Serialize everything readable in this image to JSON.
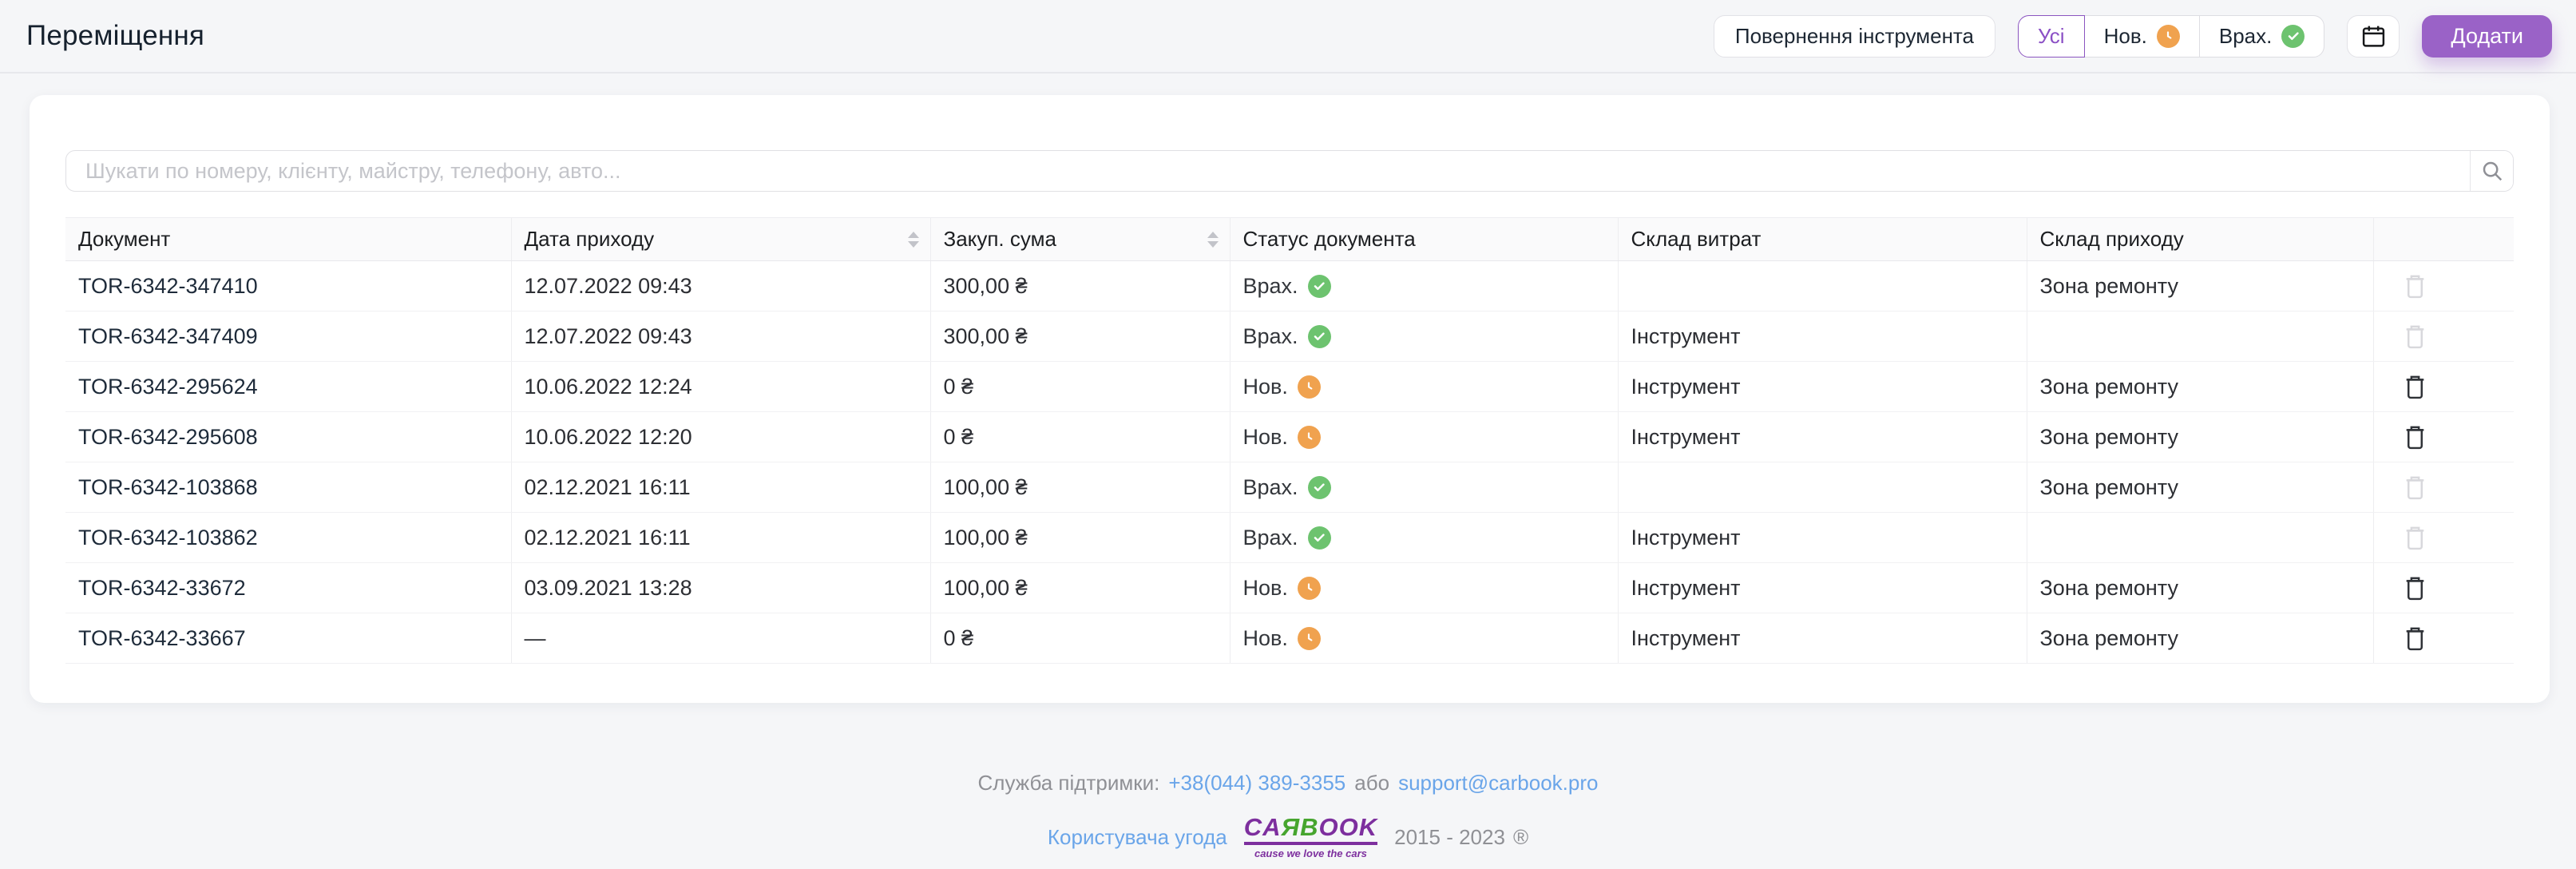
{
  "page": {
    "title": "Переміщення"
  },
  "toolbar": {
    "return_button": "Повернення інструмента",
    "filters": [
      {
        "label": "Усі",
        "active": true,
        "badge": null
      },
      {
        "label": "Нов.",
        "active": false,
        "badge": "new"
      },
      {
        "label": "Врах.",
        "active": false,
        "badge": "done"
      }
    ],
    "calendar_button": "calendar",
    "add_button": "Додати"
  },
  "search": {
    "placeholder": "Шукати по номеру, клієнту, майстру, телефону, авто..."
  },
  "table": {
    "columns": [
      "Документ",
      "Дата приходу",
      "Закуп. сума",
      "Статус документа",
      "Склад витрат",
      "Склад приходу",
      ""
    ],
    "sortable_columns": [
      "Дата приходу",
      "Закуп. сума"
    ],
    "rows": [
      {
        "doc": "TOR-6342-347410",
        "date": "12.07.2022 09:43",
        "sum": "300,00 ₴",
        "status": "Врах.",
        "status_kind": "done",
        "expense": "",
        "income": "Зона ремонту",
        "deletable": false
      },
      {
        "doc": "TOR-6342-347409",
        "date": "12.07.2022 09:43",
        "sum": "300,00 ₴",
        "status": "Врах.",
        "status_kind": "done",
        "expense": "Інструмент",
        "income": "",
        "deletable": false
      },
      {
        "doc": "TOR-6342-295624",
        "date": "10.06.2022 12:24",
        "sum": "0 ₴",
        "status": "Нов.",
        "status_kind": "new",
        "expense": "Інструмент",
        "income": "Зона ремонту",
        "deletable": true
      },
      {
        "doc": "TOR-6342-295608",
        "date": "10.06.2022 12:20",
        "sum": "0 ₴",
        "status": "Нов.",
        "status_kind": "new",
        "expense": "Інструмент",
        "income": "Зона ремонту",
        "deletable": true
      },
      {
        "doc": "TOR-6342-103868",
        "date": "02.12.2021 16:11",
        "sum": "100,00 ₴",
        "status": "Врах.",
        "status_kind": "done",
        "expense": "",
        "income": "Зона ремонту",
        "deletable": false
      },
      {
        "doc": "TOR-6342-103862",
        "date": "02.12.2021 16:11",
        "sum": "100,00 ₴",
        "status": "Врах.",
        "status_kind": "done",
        "expense": "Інструмент",
        "income": "",
        "deletable": false
      },
      {
        "doc": "TOR-6342-33672",
        "date": "03.09.2021 13:28",
        "sum": "100,00 ₴",
        "status": "Нов.",
        "status_kind": "new",
        "expense": "Інструмент",
        "income": "Зона ремонту",
        "deletable": true
      },
      {
        "doc": "TOR-6342-33667",
        "date": "—",
        "sum": "0 ₴",
        "status": "Нов.",
        "status_kind": "new",
        "expense": "Інструмент",
        "income": "Зона ремонту",
        "deletable": true
      }
    ]
  },
  "footer": {
    "support_label": "Служба підтримки:",
    "phone": "+38(044) 389-3355",
    "or_text": "або",
    "email": "support@carbook.pro",
    "terms_link": "Користувача угода",
    "logo_part1": "CA",
    "logo_part2": "ЯB",
    "logo_part3": "OOK",
    "logo_tagline": "cause we love the cars",
    "years": "2015 - 2023",
    "registered_mark": "®"
  },
  "colors": {
    "accent_purple": "#9a62c7",
    "accent_purple_border": "#8b55c0",
    "badge_new_orange": "#f0a24f",
    "badge_done_green": "#6dc36f",
    "link_blue": "#6aa5e9",
    "logo_purple": "#7d2f9e",
    "logo_green": "#46a52e",
    "page_bg": "#f5f6f8"
  }
}
